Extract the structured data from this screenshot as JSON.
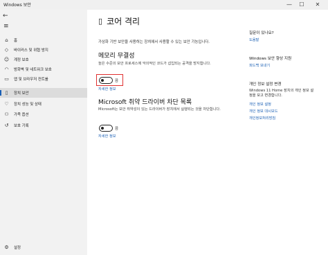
{
  "window": {
    "title": "Windows 보안",
    "minimize": "—",
    "maximize": "☐",
    "close": "✕"
  },
  "sidebar": {
    "back_icon": "←",
    "menu_icon": "≡",
    "items": [
      {
        "label": "홈",
        "icon": "⌂"
      },
      {
        "label": "바이러스 및 위협 방지",
        "icon": "◇"
      },
      {
        "label": "계정 보호",
        "icon": "☺"
      },
      {
        "label": "방화벽 및 네트워크 보호",
        "icon": "◠"
      },
      {
        "label": "앱 및 브라우저 컨트롤",
        "icon": "▭"
      },
      {
        "label": "장치 보안",
        "icon": "▯"
      },
      {
        "label": "장치 성능 및 상태",
        "icon": "♡"
      },
      {
        "label": "가족 옵션",
        "icon": "⚇"
      },
      {
        "label": "보호 기록",
        "icon": "↺"
      }
    ],
    "settings_label": "설정",
    "settings_icon": "⚙"
  },
  "main": {
    "title": "코어 격리",
    "title_icon": "▯",
    "description": "가상화 기반 보안을 사용하는 장치에서 사용할 수 있는 보안 기능입니다.",
    "sections": [
      {
        "heading": "메모리 무결성",
        "text": "높은 수준의 보안 프로세스에 악의적인 코드가 삽입되는 공격을 방지합니다.",
        "toggle_state": "끔",
        "link": "자세한 정보"
      },
      {
        "heading": "Microsoft 취약 드라이버 차단 목록",
        "text": "Microsoft는 보안 취약성이 있는 드라이버가 장치에서 실행되는 것을 차단합니다.",
        "toggle_state": "끔",
        "link": "자세한 정보"
      }
    ]
  },
  "right_panel": {
    "question_heading": "질문이 있나요?",
    "help_link": "도움말",
    "improve_heading": "Windows 보안 향상 지원",
    "feedback_link": "피드백 보내기",
    "privacy_heading": "개인 정보 설정 변경",
    "privacy_text": "Windows 11 Home 장치의 개인 정보 설정을 보고 변경합니다.",
    "privacy_links": [
      "개인 정보 설정",
      "개인 정보 대시보드",
      "개인정보처리방침"
    ]
  }
}
